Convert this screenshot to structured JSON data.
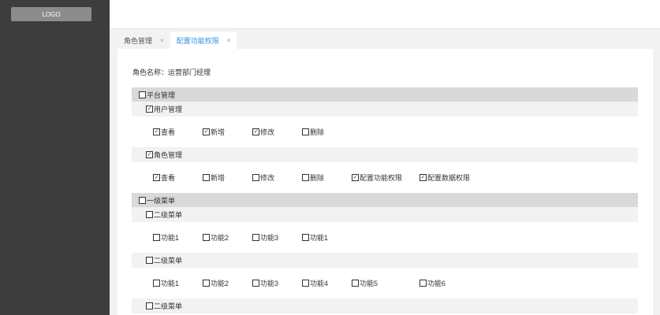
{
  "sidebar": {
    "logo": "LOGO"
  },
  "tabs": [
    {
      "label": "角色管理",
      "close": "×",
      "active": false
    },
    {
      "label": "配置功能权限",
      "close": "×",
      "active": true
    }
  ],
  "role": {
    "label": "角色名称：运营部门经理"
  },
  "permissions": [
    {
      "label": "平台管理",
      "checked": false
    },
    {
      "label": "用户管理",
      "checked": true
    },
    {
      "items": [
        {
          "label": "查看",
          "checked": true
        },
        {
          "label": "新增",
          "checked": true
        },
        {
          "label": "修改",
          "checked": true
        },
        {
          "label": "删除",
          "checked": false
        }
      ]
    },
    {
      "label": "角色管理",
      "checked": true
    },
    {
      "items": [
        {
          "label": "查看",
          "checked": true
        },
        {
          "label": "新增",
          "checked": false
        },
        {
          "label": "修改",
          "checked": false
        },
        {
          "label": "删除",
          "checked": false
        },
        {
          "label": "配置功能权限",
          "checked": true
        },
        {
          "label": "配置数据权限",
          "checked": true
        }
      ]
    },
    {
      "label": "一级菜单",
      "checked": false
    },
    {
      "label": "二级菜单",
      "checked": false
    },
    {
      "items": [
        {
          "label": "功能1",
          "checked": false
        },
        {
          "label": "功能2",
          "checked": false
        },
        {
          "label": "功能3",
          "checked": false
        },
        {
          "label": "功能1",
          "checked": false
        }
      ]
    },
    {
      "label": "二级菜单",
      "checked": false
    },
    {
      "items": [
        {
          "label": "功能1",
          "checked": false
        },
        {
          "label": "功能2",
          "checked": false
        },
        {
          "label": "功能3",
          "checked": false
        },
        {
          "label": "功能4",
          "checked": false
        },
        {
          "label": "功能5",
          "checked": false
        },
        {
          "label": "功能6",
          "checked": false
        }
      ]
    },
    {
      "label": "二级菜单",
      "checked": false
    }
  ],
  "colors": {
    "sidebar": "#3d3d3d",
    "accent": "#3a8ee6",
    "level1_bg": "#d9d9d9",
    "level2_bg": "#f2f2f2"
  },
  "icons": {
    "checked": "checkbox-checked-icon",
    "unchecked": "checkbox-unchecked-icon",
    "close": "close-icon"
  }
}
